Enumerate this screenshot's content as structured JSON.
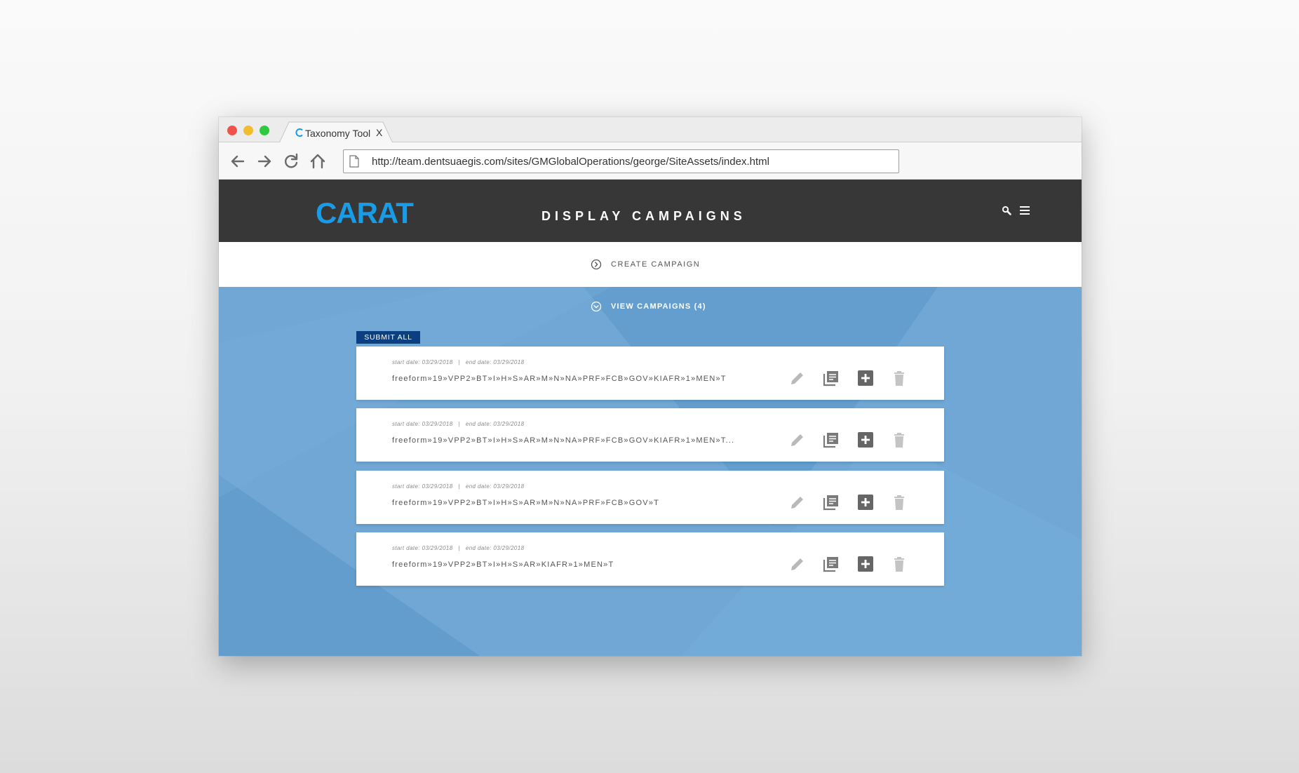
{
  "browser": {
    "tab_title": "Taxonomy Tool",
    "tab_close": "X",
    "url": "http://team.dentsuaegis.com/sites/GMGlobalOperations/george/SiteAssets/index.html",
    "traffic_lights": [
      "#f0534d",
      "#f2bd2c",
      "#2dc93f"
    ]
  },
  "header": {
    "logo": "CARAT",
    "title": "DISPLAY CAMPAIGNS",
    "logo_color": "#1a9be6",
    "background": "#373737"
  },
  "create": {
    "label": "CREATE CAMPAIGN"
  },
  "view": {
    "label": "VIEW CAMPAIGNS (4)"
  },
  "submit_all": {
    "label": "SUBMIT ALL"
  },
  "campaigns": [
    {
      "dates": "start date: 03/29/2018   |   end date: 03/29/2018",
      "name": "freeform»19»VPP2»BT»I»H»S»AR»M»N»NA»PRF»FCB»GOV»KIAFR»1»MEN»T"
    },
    {
      "dates": "start date: 03/29/2018   |   end date: 03/29/2018",
      "name": "freeform»19»VPP2»BT»I»H»S»AR»M»N»NA»PRF»FCB»GOV»KIAFR»1»MEN»T..."
    },
    {
      "dates": "start date: 03/29/2018   |   end date: 03/29/2018",
      "name": "freeform»19»VPP2»BT»I»H»S»AR»M»N»NA»PRF»FCB»GOV»T"
    },
    {
      "dates": "start date: 03/29/2018   |   end date: 03/29/2018",
      "name": "freeform»19»VPP2»BT»I»H»S»AR»KIAFR»1»MEN»T"
    }
  ],
  "icons": {
    "edit": "pencil-icon",
    "copy": "copy-icon",
    "add": "plus-box-icon",
    "delete": "trash-icon",
    "search": "search-icon",
    "menu": "hamburger-menu-icon"
  },
  "colors": {
    "blue_area": "#70a7d5",
    "submit_button": "#0b3f7f"
  }
}
